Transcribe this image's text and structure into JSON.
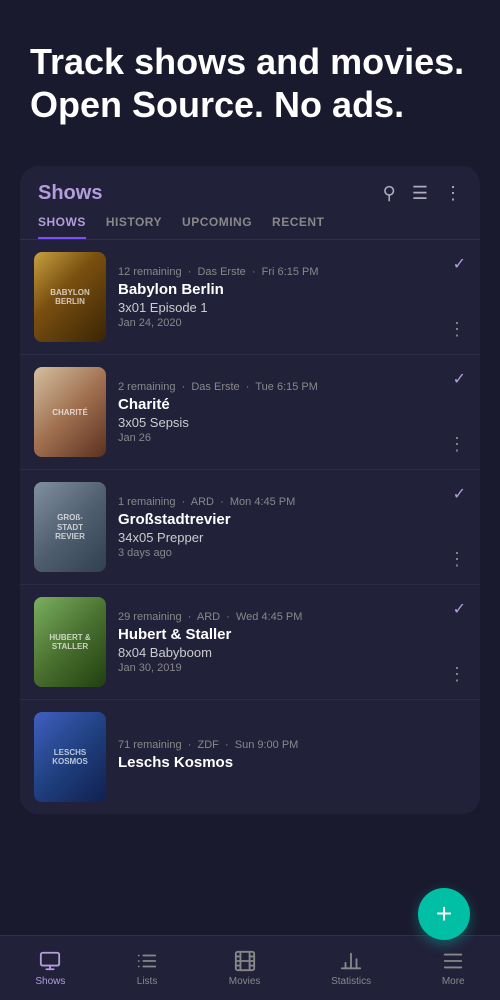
{
  "hero": {
    "title": "Track shows and movies. Open Source. No ads."
  },
  "card": {
    "header": {
      "title": "Shows"
    },
    "tabs": [
      {
        "id": "shows",
        "label": "SHOWS",
        "active": true
      },
      {
        "id": "history",
        "label": "HISTORY",
        "active": false
      },
      {
        "id": "upcoming",
        "label": "UPCOMING",
        "active": false
      },
      {
        "id": "recent",
        "label": "RECENT",
        "active": false
      }
    ],
    "shows": [
      {
        "id": "babylon",
        "thumb_label": "BABYLON BERLIN",
        "thumb_class": "thumb-babylon",
        "remaining": "12 remaining",
        "network": "Das Erste",
        "time": "Fri 6:15 PM",
        "name": "Babylon Berlin",
        "episode": "3x01 Episode 1",
        "date": "Jan 24, 2020",
        "has_check": true
      },
      {
        "id": "charite",
        "thumb_label": "CHARITÉ",
        "thumb_class": "thumb-charite",
        "remaining": "2 remaining",
        "network": "Das Erste",
        "time": "Tue 6:15 PM",
        "name": "Charité",
        "episode": "3x05 Sepsis",
        "date": "Jan 26",
        "has_check": true
      },
      {
        "id": "grossstadt",
        "thumb_label": "GROßSTADT REVIER",
        "thumb_class": "thumb-gross",
        "remaining": "1 remaining",
        "network": "ARD",
        "time": "Mon 4:45 PM",
        "name": "Großstadtrevier",
        "episode": "34x05 Prepper",
        "date": "3 days ago",
        "has_check": true
      },
      {
        "id": "hubert",
        "thumb_label": "HUBERT & STALLER",
        "thumb_class": "thumb-hubert",
        "remaining": "29 remaining",
        "network": "ARD",
        "time": "Wed 4:45 PM",
        "name": "Hubert & Staller",
        "episode": "8x04 Babyboom",
        "date": "Jan 30, 2019",
        "has_check": true
      },
      {
        "id": "leschs",
        "thumb_label": "LESCHS KOSMOS",
        "thumb_class": "thumb-leschs",
        "remaining": "71 remaining",
        "network": "ZDF",
        "time": "Sun 9:00 PM",
        "name": "Leschs Kosmos",
        "episode": "",
        "date": "",
        "has_check": false
      }
    ]
  },
  "fab": {
    "label": "+"
  },
  "bottom_nav": {
    "items": [
      {
        "id": "shows",
        "label": "Shows",
        "icon": "tv",
        "active": true
      },
      {
        "id": "lists",
        "label": "Lists",
        "icon": "list",
        "active": false
      },
      {
        "id": "movies",
        "label": "Movies",
        "icon": "film",
        "active": false
      },
      {
        "id": "statistics",
        "label": "Statistics",
        "icon": "bar-chart",
        "active": false
      },
      {
        "id": "more",
        "label": "More",
        "icon": "more",
        "active": false
      }
    ]
  }
}
